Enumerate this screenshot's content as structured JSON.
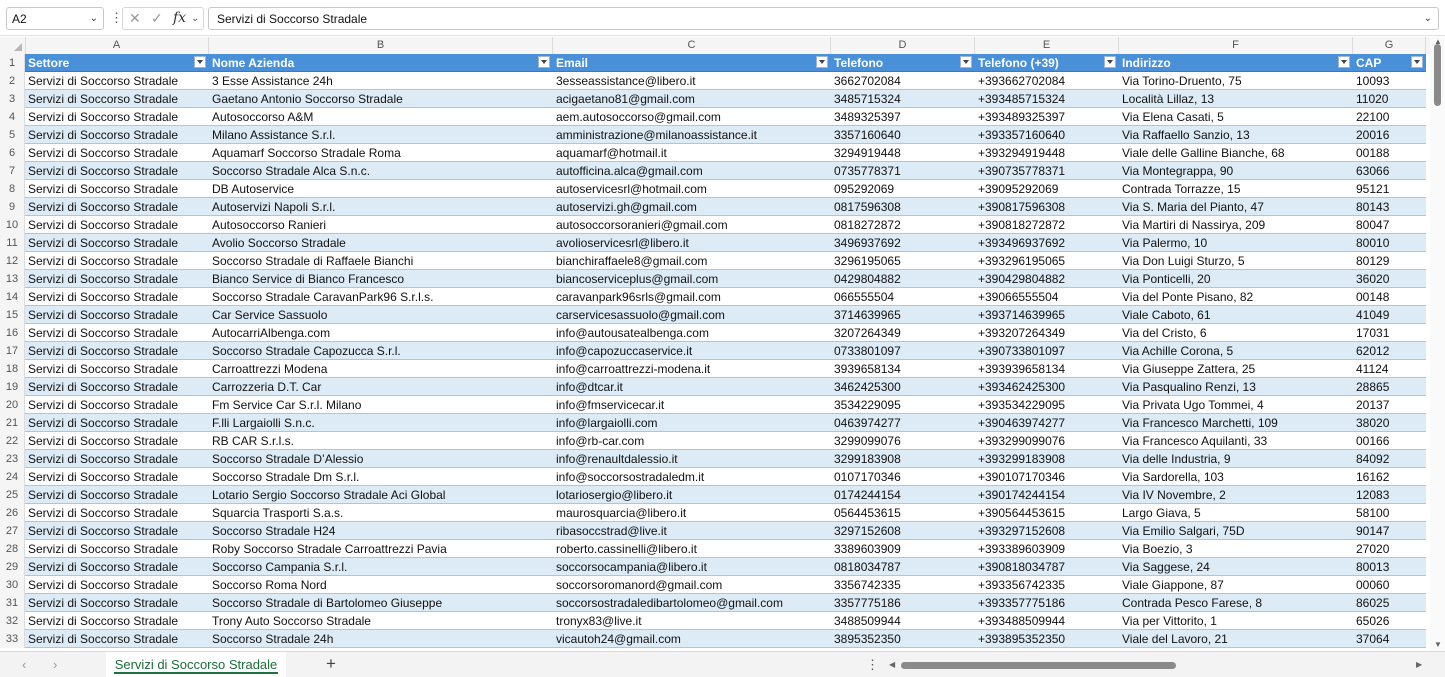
{
  "formula_bar": {
    "cell_ref": "A2",
    "value": "Servizi di Soccorso Stradale"
  },
  "column_letters": [
    "A",
    "B",
    "C",
    "D",
    "E",
    "F",
    "G"
  ],
  "table": {
    "headers": [
      "Settore",
      "Nome Azienda",
      "Email",
      "Telefono",
      "Telefono (+39)",
      "Indirizzo",
      "CAP"
    ],
    "rows": [
      [
        "Servizi di Soccorso Stradale",
        "3 Esse Assistance 24h",
        "3esseassistance@libero.it",
        "3662702084",
        "+393662702084",
        "Via Torino-Druento, 75",
        "10093"
      ],
      [
        "Servizi di Soccorso Stradale",
        "Gaetano Antonio Soccorso Stradale",
        "acigaetano81@gmail.com",
        "3485715324",
        "+393485715324",
        "Località Lillaz, 13",
        "11020"
      ],
      [
        "Servizi di Soccorso Stradale",
        "Autosoccorso A&M",
        "aem.autosoccorso@gmail.com",
        "3489325397",
        "+393489325397",
        "Via Elena Casati, 5",
        "22100"
      ],
      [
        "Servizi di Soccorso Stradale",
        "Milano Assistance S.r.l.",
        "amministrazione@milanoassistance.it",
        "3357160640",
        "+393357160640",
        "Via Raffaello Sanzio, 13",
        "20016"
      ],
      [
        "Servizi di Soccorso Stradale",
        "Aquamarf Soccorso Stradale Roma",
        "aquamarf@hotmail.it",
        "3294919448",
        "+393294919448",
        "Viale delle Galline Bianche, 68",
        "00188"
      ],
      [
        "Servizi di Soccorso Stradale",
        "Soccorso Stradale Alca S.n.c.",
        "autofficina.alca@gmail.com",
        "0735778371",
        "+390735778371",
        "Via Montegrappa, 90",
        "63066"
      ],
      [
        "Servizi di Soccorso Stradale",
        "DB Autoservice",
        "autoservicesrl@hotmail.com",
        "095292069",
        "+39095292069",
        "Contrada Torrazze, 15",
        "95121"
      ],
      [
        "Servizi di Soccorso Stradale",
        "Autoservizi Napoli S.r.l.",
        "autoservizi.gh@gmail.com",
        "0817596308",
        "+390817596308",
        "Via S. Maria del Pianto, 47",
        "80143"
      ],
      [
        "Servizi di Soccorso Stradale",
        "Autosoccorso Ranieri",
        "autosoccorsoranieri@gmail.com",
        "0818272872",
        "+390818272872",
        "Via Martiri di Nassirya, 209",
        "80047"
      ],
      [
        "Servizi di Soccorso Stradale",
        "Avolio Soccorso Stradale",
        "avolioservicesrl@libero.it",
        "3496937692",
        "+393496937692",
        "Via Palermo, 10",
        "80010"
      ],
      [
        "Servizi di Soccorso Stradale",
        "Soccorso Stradale di Raffaele Bianchi",
        "bianchiraffaele8@gmail.com",
        "3296195065",
        "+393296195065",
        "Via Don Luigi Sturzo, 5",
        "80129"
      ],
      [
        "Servizi di Soccorso Stradale",
        "Bianco Service di Bianco Francesco",
        "biancoserviceplus@gmail.com",
        "0429804882",
        "+390429804882",
        "Via Ponticelli, 20",
        "36020"
      ],
      [
        "Servizi di Soccorso Stradale",
        "Soccorso Stradale CaravanPark96 S.r.l.s.",
        "caravanpark96srls@gmail.com",
        "066555504",
        "+39066555504",
        "Via del Ponte Pisano, 82",
        "00148"
      ],
      [
        "Servizi di Soccorso Stradale",
        "Car Service Sassuolo",
        "carservicesassuolo@gmail.com",
        "3714639965",
        "+393714639965",
        "Viale Caboto, 61",
        "41049"
      ],
      [
        "Servizi di Soccorso Stradale",
        "AutocarriAlbenga.com",
        "info@autousatealbenga.com",
        "3207264349",
        "+393207264349",
        "Via del Cristo, 6",
        "17031"
      ],
      [
        "Servizi di Soccorso Stradale",
        "Soccorso Stradale Capozucca S.r.l.",
        "info@capozuccaservice.it",
        "0733801097",
        "+390733801097",
        "Via Achille Corona, 5",
        "62012"
      ],
      [
        "Servizi di Soccorso Stradale",
        "Carroattrezzi Modena",
        "info@carroattrezzi-modena.it",
        "3939658134",
        "+393939658134",
        "Via Giuseppe Zattera, 25",
        "41124"
      ],
      [
        "Servizi di Soccorso Stradale",
        "Carrozzeria D.T. Car",
        "info@dtcar.it",
        "3462425300",
        "+393462425300",
        "Via Pasqualino Renzi, 13",
        "28865"
      ],
      [
        "Servizi di Soccorso Stradale",
        "Fm Service Car S.r.l. Milano",
        "info@fmservicecar.it",
        "3534229095",
        "+393534229095",
        "Via Privata Ugo Tommei, 4",
        "20137"
      ],
      [
        "Servizi di Soccorso Stradale",
        "F.lli Largaiolli S.n.c.",
        "info@largaiolli.com",
        "0463974277",
        "+390463974277",
        "Via Francesco Marchetti, 109",
        "38020"
      ],
      [
        "Servizi di Soccorso Stradale",
        "RB CAR S.r.l.s.",
        "info@rb-car.com",
        "3299099076",
        "+393299099076",
        "Via Francesco Aquilanti, 33",
        "00166"
      ],
      [
        "Servizi di Soccorso Stradale",
        "Soccorso Stradale D’Alessio",
        "info@renaultdalessio.it",
        "3299183908",
        "+393299183908",
        "Via delle Industria, 9",
        "84092"
      ],
      [
        "Servizi di Soccorso Stradale",
        "Soccorso Stradale Dm S.r.l.",
        "info@soccorsostradaledm.it",
        "0107170346",
        "+390107170346",
        "Via Sardorella, 103",
        "16162"
      ],
      [
        "Servizi di Soccorso Stradale",
        "Lotario Sergio Soccorso Stradale Aci Global",
        "lotariosergio@libero.it",
        "0174244154",
        "+390174244154",
        "Via IV Novembre, 2",
        "12083"
      ],
      [
        "Servizi di Soccorso Stradale",
        "Squarcia Trasporti S.a.s.",
        "maurosquarcia@libero.it",
        "0564453615",
        "+390564453615",
        "Largo Giava, 5",
        "58100"
      ],
      [
        "Servizi di Soccorso Stradale",
        "Soccorso Stradale H24",
        "ribasoccstrad@live.it",
        "3297152608",
        "+393297152608",
        "Via Emilio Salgari, 75D",
        "90147"
      ],
      [
        "Servizi di Soccorso Stradale",
        "Roby Soccorso Stradale Carroattrezzi Pavia",
        "roberto.cassinelli@libero.it",
        "3389603909",
        "+393389603909",
        "Via Boezio, 3",
        "27020"
      ],
      [
        "Servizi di Soccorso Stradale",
        "Soccorso Campania S.r.l.",
        "soccorsocampania@libero.it",
        "0818034787",
        "+390818034787",
        "Via Saggese, 24",
        "80013"
      ],
      [
        "Servizi di Soccorso Stradale",
        "Soccorso Roma Nord",
        "soccorsoromanord@gmail.com",
        "3356742335",
        "+393356742335",
        "Viale Giappone, 87",
        "00060"
      ],
      [
        "Servizi di Soccorso Stradale",
        "Soccorso Stradale di Bartolomeo Giuseppe",
        "soccorsostradaledibartolomeo@gmail.com",
        "3357775186",
        "+393357775186",
        "Contrada Pesco Farese, 8",
        "86025"
      ],
      [
        "Servizi di Soccorso Stradale",
        "Trony Auto Soccorso Stradale",
        "tronyx83@live.it",
        "3488509944",
        "+393488509944",
        "Via per Vittorito, 1",
        "65026"
      ],
      [
        "Servizi di Soccorso Stradale",
        "Soccorso Stradale 24h",
        "vicautoh24@gmail.com",
        "3895352350",
        "+393895352350",
        "Viale del Lavoro, 21",
        "37064"
      ]
    ]
  },
  "sheet_tab": {
    "label": "Servizi di Soccorso Stradale"
  },
  "icons": {
    "cancel": "close-icon",
    "confirm": "check-icon",
    "function": "fx-icon",
    "add_sheet": "plus-icon"
  }
}
